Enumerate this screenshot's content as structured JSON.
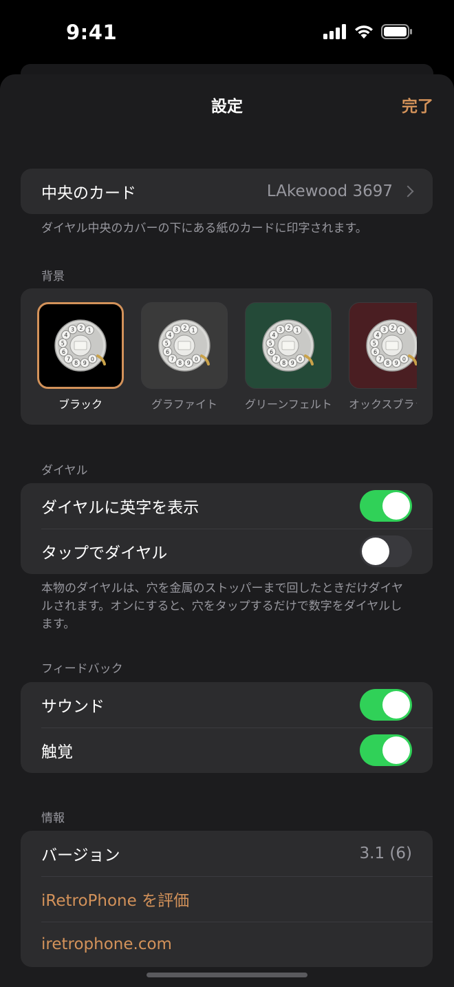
{
  "status": {
    "time": "9:41",
    "icons": [
      "cellular-signal-icon",
      "wifi-icon",
      "battery-icon"
    ]
  },
  "nav": {
    "title": "設定",
    "done": "完了"
  },
  "card": {
    "label": "中央のカード",
    "value": "LAkewood 3697",
    "caption": "ダイヤル中央のカバーの下にある紙のカードに印字されます。"
  },
  "background": {
    "header": "背景",
    "items": [
      {
        "label": "ブラック",
        "selected": true,
        "color": "#000000"
      },
      {
        "label": "グラファイト",
        "selected": false,
        "color": "#3a3a3a"
      },
      {
        "label": "グリーンフェルト",
        "selected": false,
        "color": "#244a38"
      },
      {
        "label": "オックスブラッド",
        "selected": false,
        "color": "#4a1e22"
      }
    ]
  },
  "dial": {
    "header": "ダイヤル",
    "show_letters": {
      "label": "ダイヤルに英字を表示",
      "on": true
    },
    "tap_to_dial": {
      "label": "タップでダイヤル",
      "on": false
    },
    "caption": "本物のダイヤルは、穴を金属のストッパーまで回したときだけダイヤルされます。オンにすると、穴をタップするだけで数字をダイヤルします。"
  },
  "feedback": {
    "header": "フィードバック",
    "sound": {
      "label": "サウンド",
      "on": true
    },
    "haptics": {
      "label": "触覚",
      "on": true
    }
  },
  "info": {
    "header": "情報",
    "version_label": "バージョン",
    "version_value": "3.1 (6)",
    "rate": "iRetroPhone を評価",
    "website": "iretrophone.com"
  },
  "colors": {
    "accent": "#d3925a",
    "toggle_on": "#30d158",
    "group_bg": "#2c2c2e",
    "sheet_bg": "#1c1c1e"
  },
  "dial_digits": [
    "1",
    "2",
    "3",
    "4",
    "5",
    "6",
    "7",
    "8",
    "9",
    "0"
  ]
}
